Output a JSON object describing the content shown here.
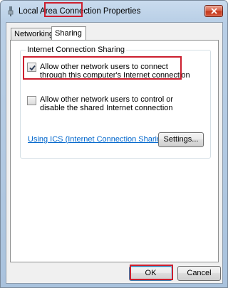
{
  "window": {
    "title": "Local Area Connection Properties",
    "accent_close": "#c43a1d"
  },
  "tabs": [
    {
      "label": "Networking",
      "active": false
    },
    {
      "label": "Sharing",
      "active": true
    }
  ],
  "sharing": {
    "group_label": "Internet Connection Sharing",
    "option_allow_connect": {
      "label": "Allow other network users to connect through this computer's Internet connection",
      "checked": true
    },
    "option_allow_control": {
      "label": "Allow other network users to control or disable the shared Internet connection",
      "checked": false
    },
    "help_link": "Using ICS (Internet Connection Sharing)",
    "settings_button": "Settings..."
  },
  "footer": {
    "ok_label": "OK",
    "cancel_label": "Cancel"
  },
  "highlight_color": "#cc1f2e"
}
